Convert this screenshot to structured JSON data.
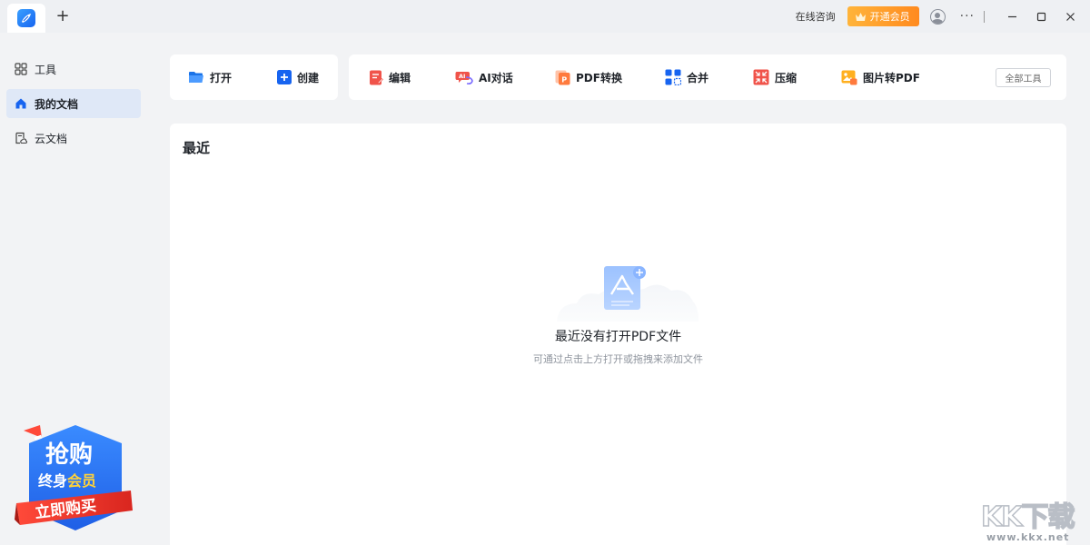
{
  "titlebar": {
    "new_tab": "+",
    "consult": "在线咨询",
    "vip": "开通会员",
    "more": "···"
  },
  "sidebar": {
    "items": [
      {
        "label": "工具",
        "icon": "grid-icon"
      },
      {
        "label": "我的文档",
        "icon": "home-icon"
      },
      {
        "label": "云文档",
        "icon": "cloud-doc-icon"
      }
    ]
  },
  "promo": {
    "line1": "抢购",
    "line2a": "终身",
    "line2b": "会员",
    "cta": "立即购买"
  },
  "toolbar": {
    "open": "打开",
    "create": "创建",
    "edit": "编辑",
    "ai": "AI对话",
    "convert": "PDF转换",
    "merge": "合并",
    "compress": "压缩",
    "img2pdf": "图片转PDF",
    "all_tools": "全部工具"
  },
  "recent": {
    "title": "最近",
    "empty_title": "最近没有打开PDF文件",
    "empty_sub": "可通过点击上方打开或拖拽来添加文件"
  },
  "watermark": {
    "text": "KK下载",
    "url": "www.kkx.net"
  },
  "colors": {
    "accent": "#1764f0",
    "vip": "#ff9a2a",
    "promo_red": "#e8382f"
  }
}
